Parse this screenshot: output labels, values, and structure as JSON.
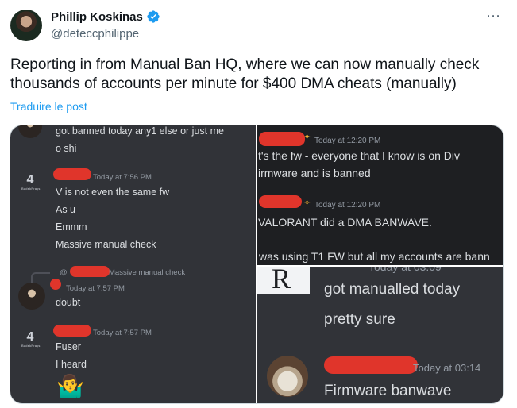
{
  "author": {
    "display_name": "Phillip Koskinas",
    "handle": "@deteccphilippe",
    "avatar_icon": "profile-photo",
    "verified_icon": "verified-badge-icon"
  },
  "more_icon": "⋯",
  "tweet": {
    "text": "Reporting in from Manual Ban HQ, where we can now manually check thousands of accounts per minute for $400 DMA cheats (manually)",
    "translate_label": "Traduire le post"
  },
  "media": {
    "left": {
      "msg1_line1": "got banned today any1 else or just me",
      "msg1_line2": "o shi",
      "msg2_time": "Today at 7:56 PM",
      "msg2_lines": [
        "V is not even the same fw",
        "As u",
        "Emmm",
        "Massive manual check"
      ],
      "reply_ref": "Massive manual check",
      "reply_at": "@",
      "msg3_time": "Today at 7:57 PM",
      "msg3_text": "doubt",
      "msg4_time": "Today at 7:57 PM",
      "msg4_lines": [
        "Fuser",
        "I heard"
      ],
      "shrug_emoji": "🤷‍♂️",
      "bot_logo_text": "4",
      "bot_logo_sub": "BadekPrays"
    },
    "top_right": {
      "time1": "Today at 12:20 PM",
      "msg1_line1": "t's the fw - everyone that I know is on Div",
      "msg1_line2": "irmware and is banned",
      "time2": "Today at 12:20 PM",
      "msg2": "VALORANT did a DMA BANWAVE.",
      "msg3": "was using T1 FW but all my accounts are bann"
    },
    "bottom_right": {
      "clipped_time": "Today at 03:09",
      "msg1": "got manualled today",
      "msg2": "pretty sure",
      "time2": "Today at 03:14",
      "msg3": "Firmware banwave",
      "r_letter": "R"
    }
  }
}
